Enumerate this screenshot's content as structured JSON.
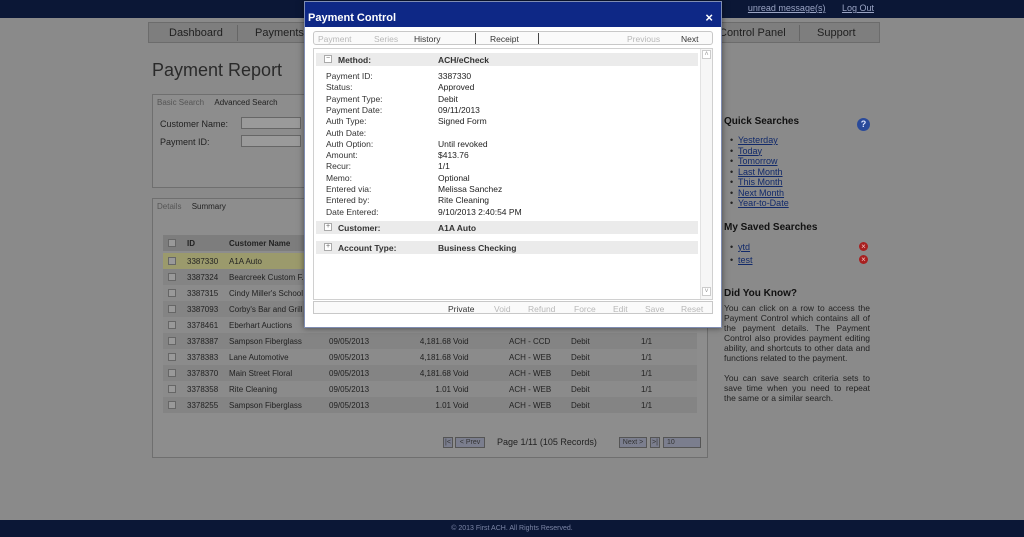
{
  "topbar": {
    "unread_link": "unread message(s)",
    "logout_link": "Log Out"
  },
  "nav": {
    "dashboard": "Dashboard",
    "payments": "Payments",
    "control_panel": "Control Panel",
    "support": "Support"
  },
  "report": {
    "title": "Payment Report",
    "search_tabs": {
      "basic": "Basic Search",
      "advanced": "Advanced Search"
    },
    "customer_name_label": "Customer Name:",
    "payment_id_label": "Payment ID:",
    "result_tabs": {
      "details": "Details",
      "summary": "Summary"
    },
    "columns": {
      "id": "ID",
      "customer_name": "Customer Name"
    },
    "rows": [
      {
        "id": "3387330",
        "customer": "A1A Auto",
        "date": "",
        "amount": "",
        "status": "",
        "type": "",
        "method": "",
        "recur": ""
      },
      {
        "id": "3387324",
        "customer": "Bearcreek Custom F...",
        "date": "",
        "amount": "",
        "status": "",
        "type": "",
        "method": "",
        "recur": ""
      },
      {
        "id": "3387315",
        "customer": "Cindy Miller's School",
        "date": "",
        "amount": "",
        "status": "",
        "type": "",
        "method": "",
        "recur": ""
      },
      {
        "id": "3387093",
        "customer": "Corby's Bar and Grill",
        "date": "",
        "amount": "",
        "status": "",
        "type": "",
        "method": "",
        "recur": ""
      },
      {
        "id": "3378461",
        "customer": "Eberhart Auctions",
        "date": "",
        "amount": "",
        "status": "",
        "type": "",
        "method": "",
        "recur": ""
      },
      {
        "id": "3378387",
        "customer": "Sampson Fiberglass",
        "date": "09/05/2013",
        "amount": "4,181.68",
        "status": "Void",
        "type": "ACH - CCD",
        "method": "Debit",
        "recur": "1/1"
      },
      {
        "id": "3378383",
        "customer": "Lane Automotive",
        "date": "09/05/2013",
        "amount": "4,181.68",
        "status": "Void",
        "type": "ACH - WEB",
        "method": "Debit",
        "recur": "1/1"
      },
      {
        "id": "3378370",
        "customer": "Main Street Floral",
        "date": "09/05/2013",
        "amount": "4,181.68",
        "status": "Void",
        "type": "ACH - WEB",
        "method": "Debit",
        "recur": "1/1"
      },
      {
        "id": "3378358",
        "customer": "Rite Cleaning",
        "date": "09/05/2013",
        "amount": "1.01",
        "status": "Void",
        "type": "ACH - WEB",
        "method": "Debit",
        "recur": "1/1"
      },
      {
        "id": "3378255",
        "customer": "Sampson Fiberglass",
        "date": "09/05/2013",
        "amount": "1.01",
        "status": "Void",
        "type": "ACH - WEB",
        "method": "Debit",
        "recur": "1/1"
      }
    ],
    "pager": {
      "prev_first": "|<",
      "prev": "< Prev",
      "status": "Page 1/11 (105 Records)",
      "next": "Next >",
      "last": ">|",
      "per_page": "10"
    }
  },
  "sidebar": {
    "quick_searches_title": "Quick Searches",
    "quick_searches": [
      "Yesterday",
      "Today",
      "Tomorrow",
      "Last Month",
      "This Month",
      "Next Month",
      "Year-to-Date"
    ],
    "saved_searches_title": "My Saved Searches",
    "saved_searches": [
      "ytd",
      "test"
    ],
    "did_you_know_title": "Did You Know?",
    "did_you_know_1": "You can click on a row to access the Payment Control which contains all of the payment details. The Payment Control also provides payment editing ability, and shortcuts to other data and functions related to the payment.",
    "did_you_know_2": "You can save search criteria sets to save time when you need to repeat the same or a similar search."
  },
  "footer": {
    "text": "© 2013 First ACH. All Rights Reserved."
  },
  "modal": {
    "title": "Payment Control",
    "close_icon": "×",
    "tabs": {
      "payment": "Payment",
      "series": "Series",
      "history": "History",
      "receipt": "Receipt",
      "previous": "Previous",
      "next": "Next"
    },
    "method_label": "Method:",
    "method_value": "ACH/eCheck",
    "details": [
      {
        "label": "Payment ID:",
        "value": "3387330"
      },
      {
        "label": "Status:",
        "value": "Approved"
      },
      {
        "label": "Payment Type:",
        "value": "Debit"
      },
      {
        "label": "Payment Date:",
        "value": "09/11/2013"
      },
      {
        "label": "Auth Type:",
        "value": "Signed Form"
      },
      {
        "label": "Auth Date:",
        "value": ""
      },
      {
        "label": "Auth Option:",
        "value": "Until revoked"
      },
      {
        "label": "Amount:",
        "value": "$413.76"
      },
      {
        "label": "Recur:",
        "value": "1/1"
      },
      {
        "label": "Memo:",
        "value": "Optional"
      },
      {
        "label": "Entered via:",
        "value": "Melissa Sanchez"
      },
      {
        "label": "Entered by:",
        "value": "Rite Cleaning"
      },
      {
        "label": "Date Entered:",
        "value": "9/10/2013 2:40:54 PM"
      }
    ],
    "customer_label": "Customer:",
    "customer_value": "A1A Auto",
    "account_type_label": "Account Type:",
    "account_type_value": "Business Checking",
    "actions": {
      "private": "Private",
      "void": "Void",
      "refund": "Refund",
      "force": "Force",
      "edit": "Edit",
      "save": "Save",
      "reset": "Reset"
    }
  },
  "colors": {
    "modal_title_bg": "#0e2886",
    "topbar_bg": "#0b1736",
    "overlay": "#8a8a8a"
  }
}
